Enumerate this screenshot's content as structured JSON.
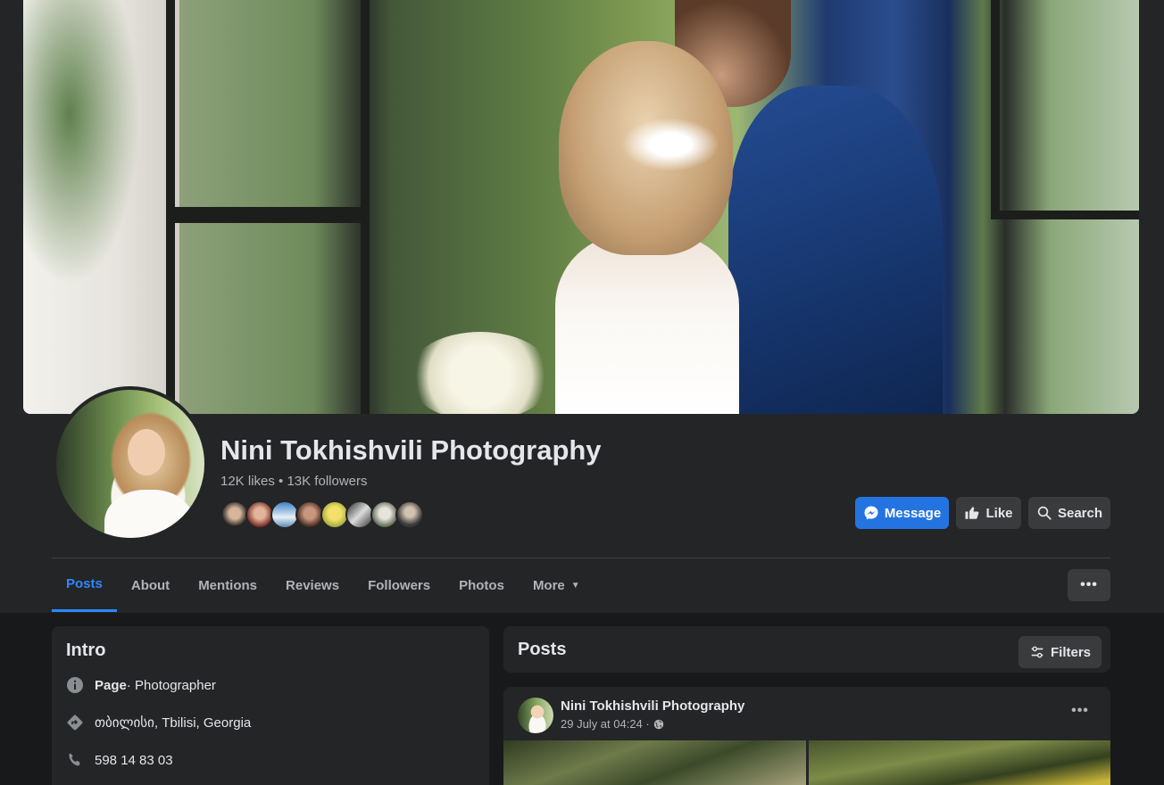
{
  "page": {
    "name": "Nini Tokhishvili Photography",
    "stats": "12K likes • 13K followers"
  },
  "actions": {
    "message": "Message",
    "like": "Like",
    "search": "Search"
  },
  "tabs": [
    {
      "label": "Posts",
      "active": true
    },
    {
      "label": "About"
    },
    {
      "label": "Mentions"
    },
    {
      "label": "Reviews"
    },
    {
      "label": "Followers"
    },
    {
      "label": "Photos"
    },
    {
      "label": "More"
    }
  ],
  "more_menu_icon": "ellipsis-icon",
  "intro": {
    "title": "Intro",
    "page_label": "Page",
    "category": " · Photographer",
    "location": "თბილისი, Tbilisi, Georgia",
    "phone": "598 14 83 03"
  },
  "posts": {
    "title": "Posts",
    "filters_label": "Filters",
    "first_post": {
      "author": "Nini Tokhishvili Photography",
      "time": "29 July at 04:24 ·"
    }
  },
  "colors": {
    "accent": "#2374e1",
    "active_tab": "#2d88ff",
    "card": "#242526",
    "background": "#18191a"
  }
}
